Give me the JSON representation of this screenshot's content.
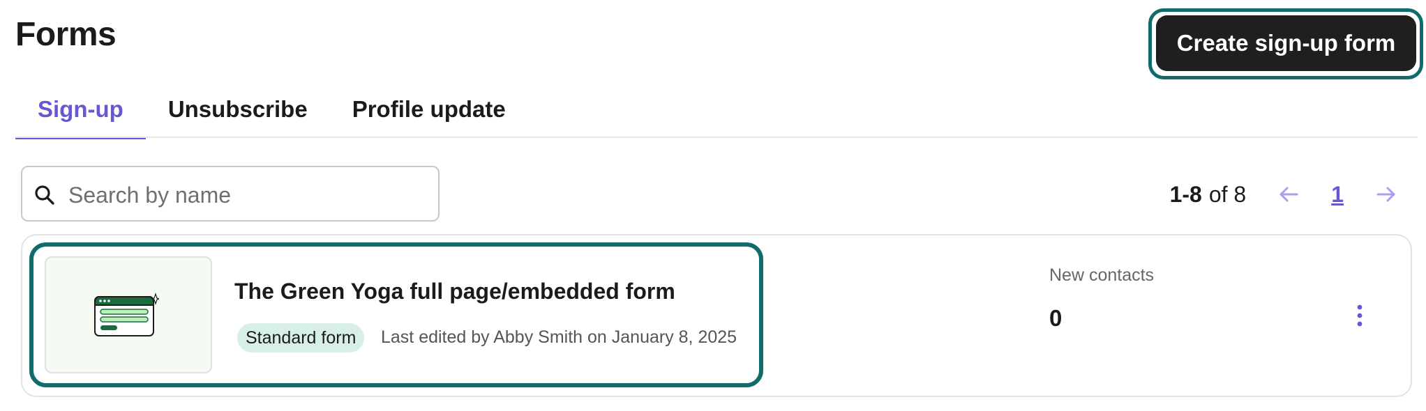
{
  "page": {
    "title": "Forms"
  },
  "header": {
    "create_label": "Create sign-up form"
  },
  "tabs": [
    {
      "label": "Sign-up",
      "active": true
    },
    {
      "label": "Unsubscribe",
      "active": false
    },
    {
      "label": "Profile update",
      "active": false
    }
  ],
  "search": {
    "placeholder": "Search by name",
    "value": "",
    "icon": "search-icon"
  },
  "pagination": {
    "range": "1-8",
    "of_text": "of 8",
    "current_page": "1",
    "prev_icon": "arrow-left-icon",
    "next_icon": "arrow-right-icon"
  },
  "forms": [
    {
      "name": "The Green Yoga full page/embedded form",
      "type_badge": "Standard form",
      "edited": "Last edited by Abby Smith on January 8, 2025",
      "metric_label": "New contacts",
      "metric_value": "0",
      "thumbnail_icon": "form-illustration-icon",
      "menu_icon": "more-vertical-icon"
    }
  ],
  "colors": {
    "accent": "#6658d3",
    "focus_ring": "#106b6b",
    "badge_bg": "#d7efe6",
    "button_bg": "#1f1f1f"
  }
}
